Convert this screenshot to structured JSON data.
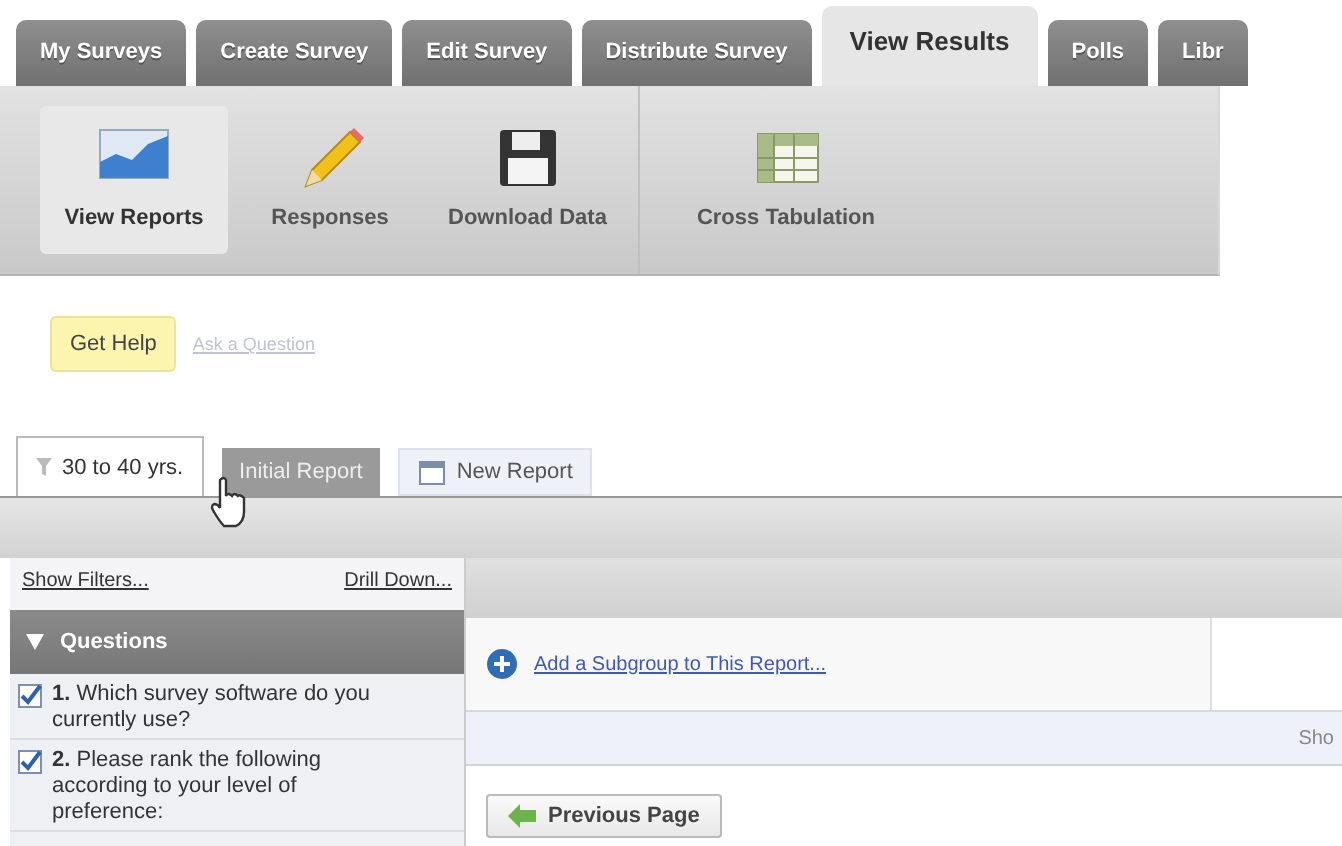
{
  "top_tabs": [
    {
      "label": "My Surveys",
      "selected": false
    },
    {
      "label": "Create Survey",
      "selected": false
    },
    {
      "label": "Edit Survey",
      "selected": false
    },
    {
      "label": "Distribute Survey",
      "selected": false
    },
    {
      "label": "View Results",
      "selected": true
    },
    {
      "label": "Polls",
      "selected": false
    },
    {
      "label": "Libr",
      "selected": false
    }
  ],
  "toolbar": {
    "groups": [
      [
        {
          "label": "View Reports",
          "kind": "chart",
          "selected": true
        },
        {
          "label": "Responses",
          "kind": "pencil",
          "selected": false
        },
        {
          "label": "Download Data",
          "kind": "disk",
          "selected": false
        }
      ],
      [
        {
          "label": "Cross Tabulation",
          "kind": "grid",
          "selected": false
        }
      ]
    ]
  },
  "help": {
    "button": "Get Help",
    "link": "Ask a Question"
  },
  "report_tabs": [
    {
      "label": "30 to 40 yrs.",
      "kind": "filter",
      "selected": true
    },
    {
      "label": "Initial Report",
      "kind": "plain",
      "selected": false
    },
    {
      "label": "New Report",
      "kind": "new",
      "selected": false
    }
  ],
  "sidebar": {
    "links": [
      "Show Filters...",
      "Drill Down..."
    ],
    "section": {
      "title": "Questions",
      "expanded": true
    },
    "questions": [
      {
        "text": "**1.** Which survey software do you currently use?",
        "checked": true
      },
      {
        "text": "**2.** Please rank the following according to your level of preference:",
        "checked": true
      }
    ]
  },
  "content": {
    "add_link": "Add a Subgroup to This Report...",
    "band_text": "Sho",
    "prev_button": "Previous Page"
  }
}
